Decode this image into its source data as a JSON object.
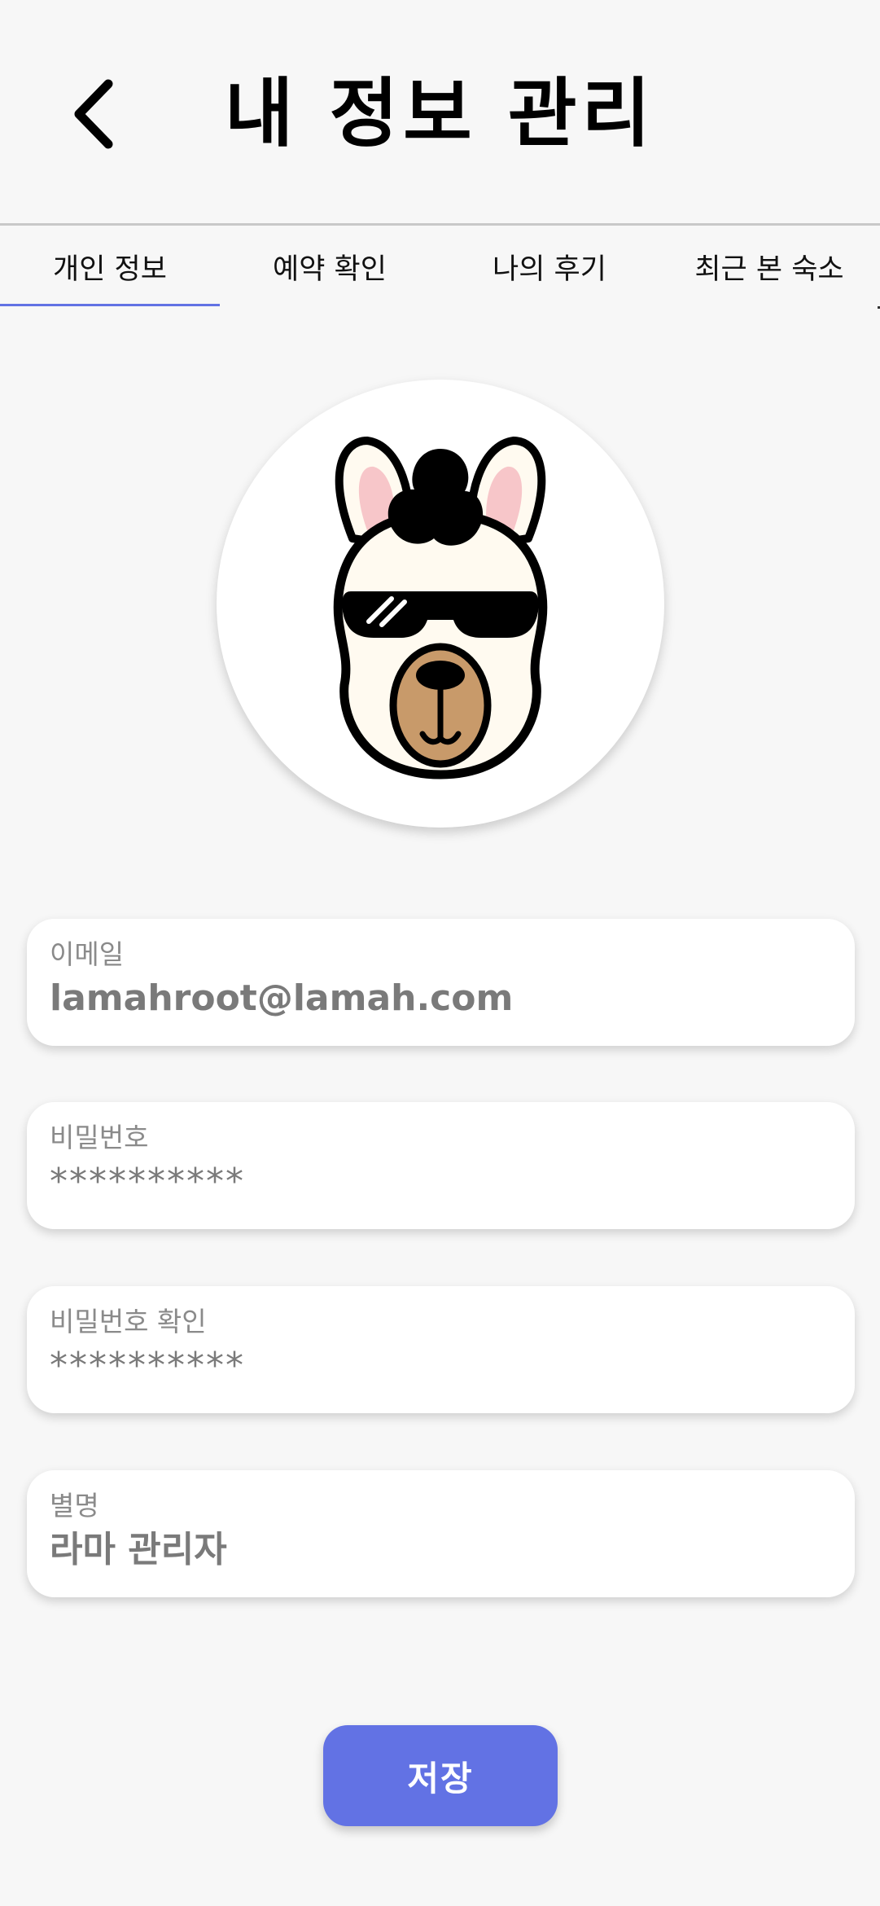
{
  "header": {
    "title": "내 정보 관리",
    "back_icon": "chevron-left-icon"
  },
  "tabs": [
    {
      "label": "개인 정보",
      "active": true
    },
    {
      "label": "예약 확인",
      "active": false
    },
    {
      "label": "나의 후기",
      "active": false
    },
    {
      "label": "최근 본 숙소",
      "active": false
    }
  ],
  "avatar": {
    "icon": "llama-avatar-icon"
  },
  "form": {
    "email": {
      "label": "이메일",
      "value": "lamahroot@lamah.com"
    },
    "password": {
      "label": "비밀번호",
      "value": "**********"
    },
    "password_confirm": {
      "label": "비밀번호 확인",
      "value": "**********"
    },
    "nickname": {
      "label": "별명",
      "value": "라마 관리자"
    }
  },
  "save_button": {
    "label": "저장"
  },
  "colors": {
    "accent": "#6272e4",
    "background": "#f7f7f7",
    "label": "#8a8a8a",
    "value": "#7a7a7a"
  }
}
